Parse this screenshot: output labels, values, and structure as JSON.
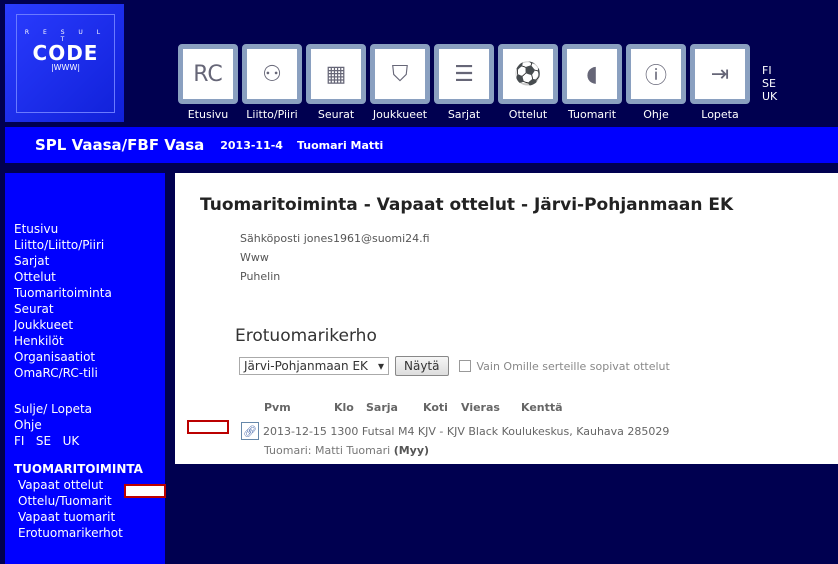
{
  "logo": {
    "top": "R E S U L T",
    "main": "CODE",
    "sub": "|WWW|"
  },
  "topnav": [
    {
      "label": "Etusivu",
      "icon": "resultcode-icon"
    },
    {
      "label": "Liitto/Piiri",
      "icon": "network-icon"
    },
    {
      "label": "Seurat",
      "icon": "clubs-icon"
    },
    {
      "label": "Joukkueet",
      "icon": "team-icon"
    },
    {
      "label": "Sarjat",
      "icon": "series-icon"
    },
    {
      "label": "Ottelut",
      "icon": "match-icon"
    },
    {
      "label": "Tuomarit",
      "icon": "whistle-icon"
    },
    {
      "label": "Ohje",
      "icon": "info-icon"
    },
    {
      "label": "Lopeta",
      "icon": "exit-icon"
    }
  ],
  "languages": [
    "FI",
    "SE",
    "UK"
  ],
  "header": {
    "title": "SPL Vaasa/FBF Vasa",
    "date": "2013-11-4",
    "user": "Tuomari Matti"
  },
  "sidebar": {
    "items": [
      "Etusivu",
      "Liitto/Liitto/Piiri",
      "Sarjat",
      "Ottelut",
      "Tuomaritoiminta",
      "Seurat",
      "Joukkueet",
      "Henkilöt",
      "Organisaatiot",
      "OmaRC/RC-tili"
    ],
    "items2": [
      "Sulje/ Lopeta",
      "Ohje"
    ],
    "langs": [
      "FI",
      "SE",
      "UK"
    ],
    "section": "TUOMARITOIMINTA",
    "sub": [
      "Vapaat ottelut",
      "Ottelu/Tuomarit",
      "Vapaat tuomarit",
      "Erotuomarikerhot"
    ]
  },
  "main": {
    "title": "Tuomaritoiminta - Vapaat ottelut - Järvi-Pohjanmaan EK",
    "info": [
      "Sähköposti jones1961@suomi24.fi",
      "Www",
      "Puhelin"
    ],
    "section": "Erotuomarikerho",
    "select": "Järvi-Pohjanmaan EK",
    "show": "Näytä",
    "checkbox": "Vain Omille serteille sopivat ottelut",
    "columns": [
      "Pvm",
      "Klo",
      "Sarja",
      "Koti",
      "Vieras",
      "Kenttä"
    ],
    "row": "2013-12-15 1300 Futsal M4  KJV - KJV Black Koulukeskus, Kauhava 285029",
    "referee_label": "Tuomari: Matti Tuomari",
    "referee_tag": "(Myy)"
  },
  "colors": {
    "background": "#000050",
    "band": "#0000ff",
    "annotation": "#bb0000"
  }
}
